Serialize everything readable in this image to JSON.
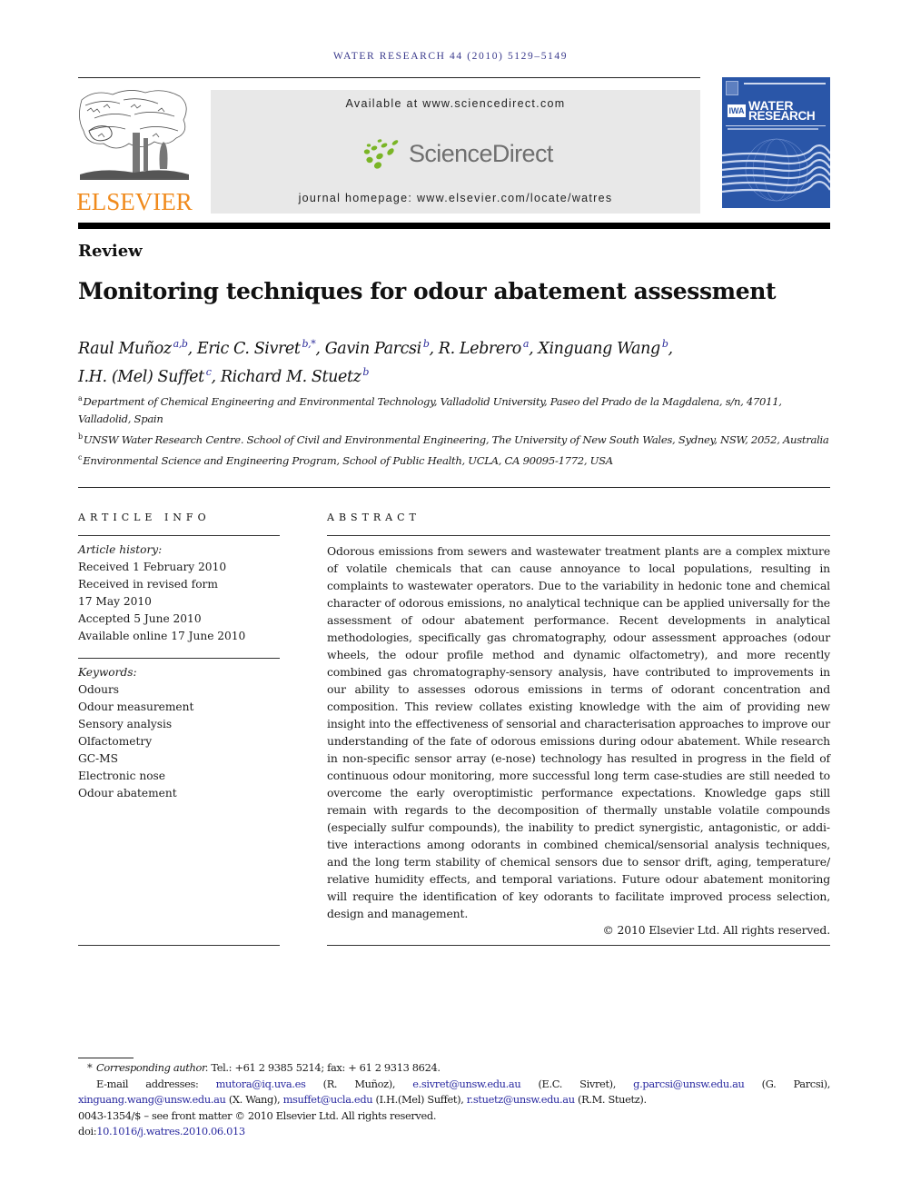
{
  "header": {
    "journal_reference": "WATER RESEARCH 44 (2010) 5129–5149",
    "publisher_wordmark": "ELSEVIER",
    "available_at": "Available at www.sciencedirect.com",
    "platform_name": "ScienceDirect",
    "journal_homepage": "journal homepage: www.elsevier.com/locate/watres",
    "cover": {
      "badge": "IWA",
      "title_line1": "WATER",
      "title_line2": "RESEARCH"
    },
    "colors": {
      "elsevier_orange": "#f08a1c",
      "sciencedirect_green": "#7ab526",
      "cover_blue": "#2a56a8",
      "link_blue": "#2a2aa0"
    }
  },
  "article": {
    "type": "Review",
    "title": "Monitoring techniques for odour abatement assessment",
    "authors": [
      {
        "name": "Raul Muñoz",
        "sup": "a,b",
        "sep": ", "
      },
      {
        "name": "Eric C. Sivret",
        "sup": "b,*",
        "sep": ", "
      },
      {
        "name": "Gavin Parcsi",
        "sup": "b",
        "sep": ", "
      },
      {
        "name": "R. Lebrero",
        "sup": "a",
        "sep": ", "
      },
      {
        "name": "Xinguang Wang",
        "sup": "b",
        "sep": ","
      },
      {
        "name": "I.H. (Mel) Suffet",
        "sup": "c",
        "sep": ", "
      },
      {
        "name": "Richard M. Stuetz",
        "sup": "b",
        "sep": ""
      }
    ],
    "affiliations": [
      {
        "key": "a",
        "text": "Department of Chemical Engineering and Environmental Technology, Valladolid University, Paseo del Prado de la Magdalena, s/n, 47011, Valladolid, Spain"
      },
      {
        "key": "b",
        "text": "UNSW Water Research Centre. School of Civil and Environmental Engineering, The University of New South Wales, Sydney, NSW, 2052, Australia"
      },
      {
        "key": "c",
        "text": "Environmental Science and Engineering Program, School of Public Health, UCLA, CA 90095-1772, USA"
      }
    ]
  },
  "article_info": {
    "heading": "ARTICLE INFO",
    "history_label": "Article history:",
    "history": [
      "Received 1 February 2010",
      "Received in revised form",
      "17 May 2010",
      "Accepted 5 June 2010",
      "Available online 17 June 2010"
    ],
    "keywords_label": "Keywords:",
    "keywords": [
      "Odours",
      "Odour measurement",
      "Sensory analysis",
      "Olfactometry",
      "GC-MS",
      "Electronic nose",
      "Odour abatement"
    ]
  },
  "abstract": {
    "heading": "ABSTRACT",
    "text": "Odorous emissions from sewers and wastewater treatment plants are a complex mixture of volatile chemicals that can cause annoyance to local populations, resulting in complaints to wastewater operators. Due to the variability in hedonic tone and chemical character of odorous emissions, no analytical technique can be applied universally for the assessment of odour abatement performance. Recent developments in analytical methodologies, specifically gas chromatography, odour assessment approaches (odour wheels, the odour profile method and dynamic olfactometry), and more recently combined gas chromatography-sensory analysis, have contributed to improvements in our ability to assesses odorous emissions in terms of odorant concentration and composition. This review collates existing knowledge with the aim of providing new insight into the effectiveness of sensorial and characterisation approaches to improve our understanding of the fate of odorous emissions during odour abatement. While research in non-specific sensor array (e-nose) technology has resulted in progress in the field of continuous odour monitoring, more successful long term case-studies are still needed to overcome the early overoptimistic performance expectations. Knowledge gaps still remain with regards to the decomposition of thermally unstable volatile compounds (especially sulfur compounds), the inability to predict synergistic, antagonistic, or addi­tive interactions among odorants in combined chemical/sensorial analysis techniques, and the long term stability of chemical sensors due to sensor drift, aging, temperature/​relative humidity effects, and temporal variations. Future odour abatement monitoring will require the identification of key odorants to facilitate improved process selection, design and management.",
    "copyright": "© 2010 Elsevier Ltd. All rights reserved."
  },
  "footnotes": {
    "star": "*",
    "corresponding_label": "Corresponding author.",
    "contact": " Tel.: +61 2 9385 5214; fax: + 61 2 9313 8624.",
    "email_label": "E-mail addresses: ",
    "emails": [
      {
        "address": "mutora@iq.uva.es",
        "owner": " (R. Muñoz), "
      },
      {
        "address": "e.sivret@unsw.edu.au",
        "owner": " (E.C. Sivret), "
      },
      {
        "address": "g.parcsi@unsw.edu.au",
        "owner": " (G. Parcsi), "
      },
      {
        "address": "xinguang.wang@unsw.edu.au",
        "owner": " (X. Wang), "
      },
      {
        "address": "msuffet@ucla.edu",
        "owner": " (I.H.(Mel) Suffet), "
      },
      {
        "address": "r.stuetz@unsw.edu.au",
        "owner": " (R.M. Stuetz)."
      }
    ],
    "front_matter": "0043-1354/$ – see front matter © 2010 Elsevier Ltd. All rights reserved.",
    "doi_prefix": "doi:",
    "doi": "10.1016/j.watres.2010.06.013"
  }
}
